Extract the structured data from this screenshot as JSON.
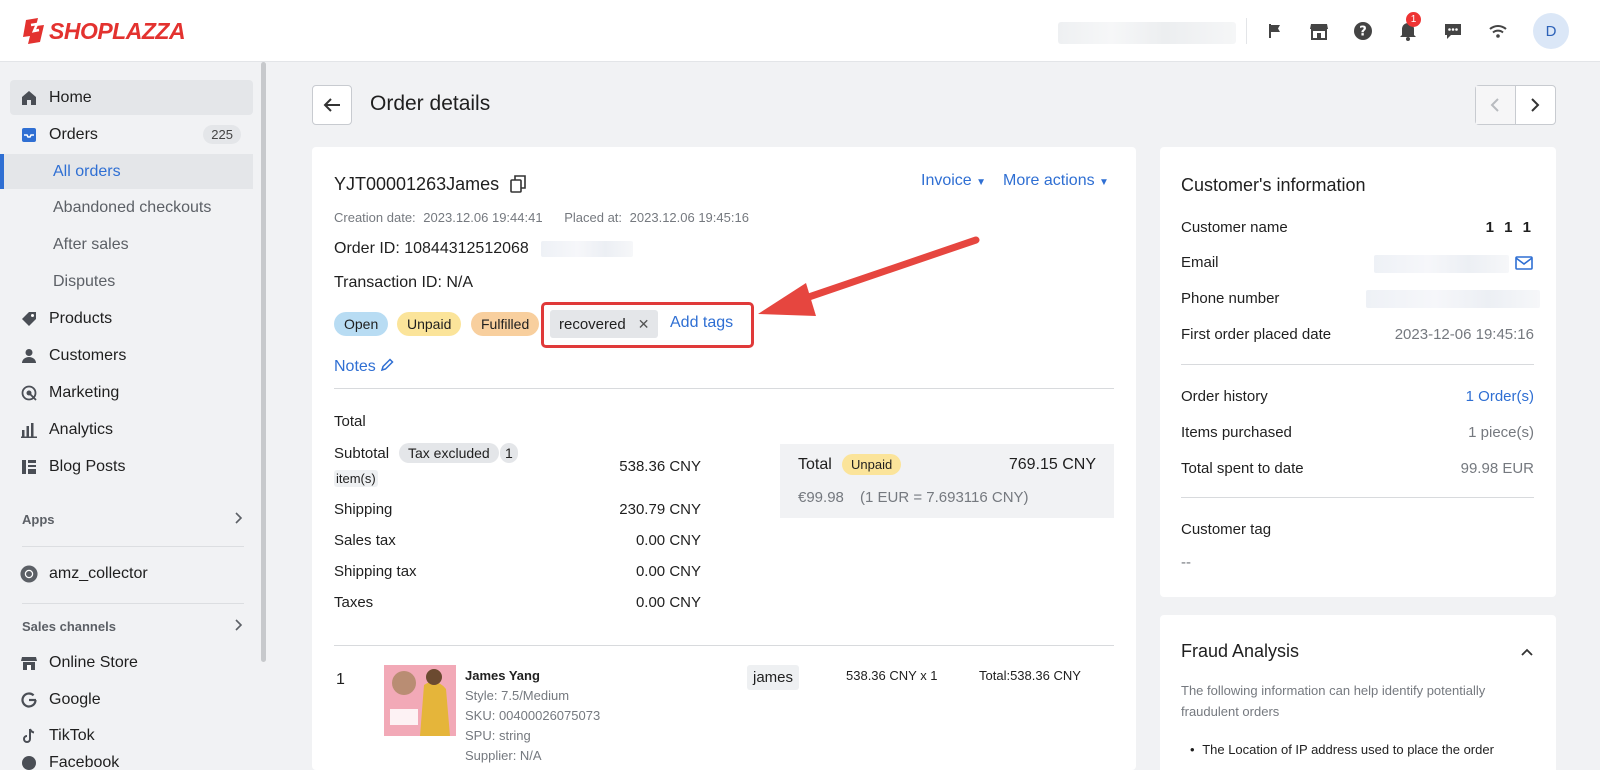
{
  "brand": {
    "name": "SHOPLAZZA",
    "color": "#e3322f"
  },
  "topbar": {
    "notification_count": "1",
    "avatar_initial": "D",
    "icons": [
      "flag-icon",
      "store-icon",
      "help-icon",
      "bell-icon",
      "chat-icon",
      "wifi-icon"
    ]
  },
  "sidebar": {
    "items": [
      {
        "label": "Home",
        "icon": "home-icon"
      },
      {
        "label": "Orders",
        "icon": "orders-icon",
        "count": "225"
      },
      {
        "label": "Products",
        "icon": "tag-icon"
      },
      {
        "label": "Customers",
        "icon": "person-icon"
      },
      {
        "label": "Marketing",
        "icon": "marketing-icon"
      },
      {
        "label": "Analytics",
        "icon": "bar-chart-icon"
      },
      {
        "label": "Blog Posts",
        "icon": "blog-icon"
      }
    ],
    "order_sub": [
      "All orders",
      "Abandoned checkouts",
      "After sales",
      "Disputes"
    ],
    "apps_title": "Apps",
    "app_item": "amz_collector",
    "sales_channels_title": "Sales channels",
    "channels": [
      "Online Store",
      "Google",
      "TikTok",
      "Facebook"
    ]
  },
  "header": {
    "title": "Order details"
  },
  "order": {
    "number": "YJT00001263James",
    "invoice_label": "Invoice",
    "more_actions_label": "More actions",
    "creation_label": "Creation date:",
    "creation_value": "2023.12.06 19:44:41",
    "placed_label": "Placed at:",
    "placed_value": "2023.12.06 19:45:16",
    "order_id": "Order ID: 10844312512068",
    "transaction_id": "Transaction ID: N/A",
    "status": [
      {
        "label": "Open",
        "bg": "#b8dcf3"
      },
      {
        "label": "Unpaid",
        "bg": "#fbe49a"
      },
      {
        "label": "Fulfilled",
        "bg": "#f8cf9e"
      }
    ],
    "tag": "recovered",
    "add_tags_label": "Add tags",
    "notes_label": "Notes"
  },
  "totals": {
    "heading": "Total",
    "subtotal_label": "Subtotal",
    "tax_excluded": "Tax excluded",
    "items_count": "1",
    "items_word": "item(s)",
    "subtotal_value": "538.36 CNY",
    "rows": [
      {
        "label": "Shipping",
        "value": "230.79 CNY"
      },
      {
        "label": "Sales tax",
        "value": "0.00 CNY"
      },
      {
        "label": "Shipping tax",
        "value": "0.00 CNY"
      },
      {
        "label": "Taxes",
        "value": "0.00 CNY"
      }
    ],
    "summary_label": "Total",
    "summary_badge": "Unpaid",
    "summary_value": "769.15 CNY",
    "summary_eur": "€99.98",
    "summary_rate": "(1 EUR = 7.693116 CNY)"
  },
  "line_item": {
    "index": "1",
    "name": "James Yang",
    "style": "Style: 7.5/Medium",
    "sku": "SKU: 00400026075073",
    "spu": "SPU: string",
    "supplier": "Supplier: N/A",
    "vendor_tag": "james",
    "qty_price": "538.36 CNY x 1",
    "total": "Total:538.36 CNY"
  },
  "customer": {
    "title": "Customer's information",
    "name_label": "Customer name",
    "name_value": "1 1 1",
    "email_label": "Email",
    "phone_label": "Phone number",
    "first_order_label": "First order placed date",
    "first_order_value": "2023-12-06 19:45:16",
    "history_label": "Order history",
    "history_value": "1 Order(s)",
    "items_label": "Items purchased",
    "items_value": "1 piece(s)",
    "spent_label": "Total spent to date",
    "spent_value": "99.98 EUR",
    "tag_label": "Customer tag",
    "tag_value": "--"
  },
  "fraud": {
    "title": "Fraud Analysis",
    "desc_line1": "The following information can help identify potentially",
    "desc_line2": "fraudulent orders",
    "bullet": "The Location of IP address used to place the order"
  }
}
